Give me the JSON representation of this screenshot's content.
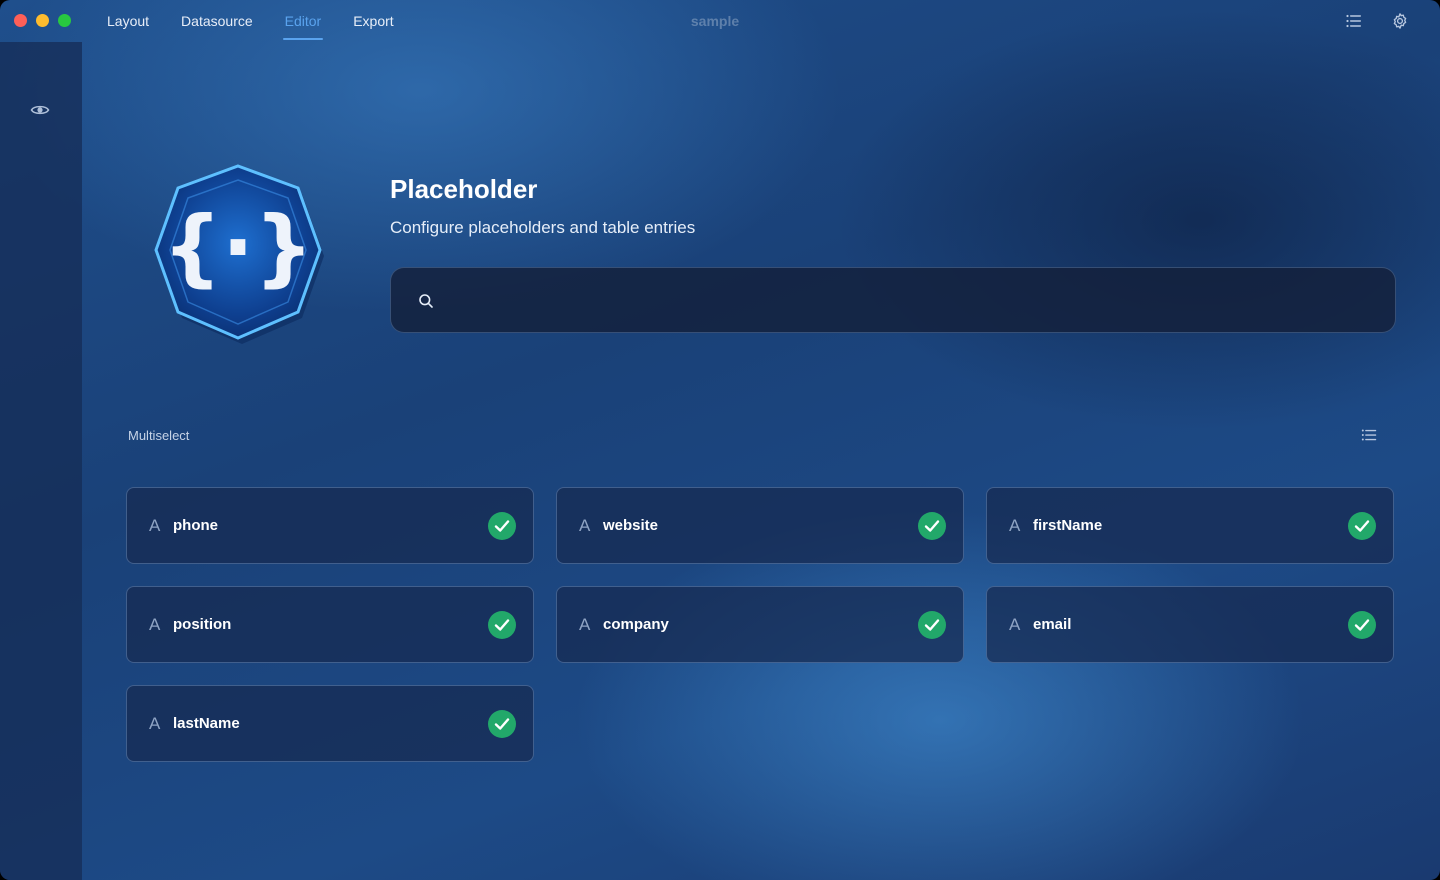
{
  "window": {
    "title": "sample"
  },
  "nav": {
    "tabs": [
      {
        "label": "Layout",
        "active": false
      },
      {
        "label": "Datasource",
        "active": false
      },
      {
        "label": "Editor",
        "active": true
      },
      {
        "label": "Export",
        "active": false
      }
    ]
  },
  "toolbar": {
    "icons": [
      "list-icon",
      "gear-icon"
    ]
  },
  "sidebar": {
    "icons": [
      "eye-icon"
    ]
  },
  "hero": {
    "title": "Placeholder",
    "subtitle": "Configure placeholders and table entries",
    "logo_icon": "curly-braces-icon"
  },
  "search": {
    "value": "",
    "placeholder": "",
    "icon": "search-icon"
  },
  "section": {
    "label": "Multiselect",
    "icon": "list-icon"
  },
  "placeholders": [
    {
      "type_glyph": "A",
      "label": "phone",
      "selected": true
    },
    {
      "type_glyph": "A",
      "label": "website",
      "selected": true
    },
    {
      "type_glyph": "A",
      "label": "firstName",
      "selected": true
    },
    {
      "type_glyph": "A",
      "label": "position",
      "selected": true
    },
    {
      "type_glyph": "A",
      "label": "company",
      "selected": true
    },
    {
      "type_glyph": "A",
      "label": "email",
      "selected": true
    },
    {
      "type_glyph": "A",
      "label": "lastName",
      "selected": true
    }
  ],
  "colors": {
    "accent": "#5aa3ee",
    "check": "#22a86a"
  }
}
